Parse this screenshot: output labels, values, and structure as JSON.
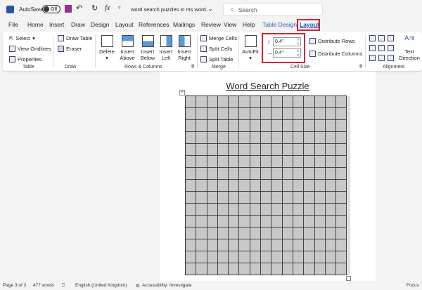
{
  "titlebar": {
    "autosave_label": "AutoSave",
    "autosave_state": "Off",
    "doc_title": "word search puzzles in ms word...",
    "search_placeholder": "Search"
  },
  "menu_tabs": [
    "File",
    "Home",
    "Insert",
    "Draw",
    "Design",
    "Layout",
    "References",
    "Mailings",
    "Review",
    "View",
    "Help",
    "Table Design",
    "Layout"
  ],
  "active_tab": "Layout",
  "ribbon": {
    "table": {
      "label": "Table",
      "select": "Select",
      "view_gridlines": "View Gridlines",
      "properties": "Properties"
    },
    "draw": {
      "label": "Draw",
      "draw_table": "Draw Table",
      "eraser": "Eraser"
    },
    "rows_columns": {
      "label": "Rows & Columns",
      "delete": "Delete",
      "insert_above": [
        "Insert",
        "Above"
      ],
      "insert_below": [
        "Insert",
        "Below"
      ],
      "insert_left": [
        "Insert",
        "Left"
      ],
      "insert_right": [
        "Insert",
        "Right"
      ]
    },
    "merge": {
      "label": "Merge",
      "merge_cells": "Merge Cells",
      "split_cells": "Split Cells",
      "split_table": "Split Table"
    },
    "cell_size": {
      "label": "Cell Size",
      "autofit": "AutoFit",
      "height": "0.4\"",
      "width": "0.4\"",
      "distribute_rows": "Distribute Rows",
      "distribute_columns": "Distribute Columns"
    },
    "alignment": {
      "label": "Alignment",
      "text_direction": [
        "Text",
        "Direction"
      ]
    }
  },
  "document": {
    "title": "Word Search Puzzle",
    "grid_rows": 15,
    "grid_cols": 15,
    "cell_color": "#c8c8c8"
  },
  "status": {
    "page": "Page 3 of 3",
    "words": "477 words",
    "language": "English (United Kingdom)",
    "accessibility": "Accessibility: Investigate",
    "focus": "Focus"
  },
  "colors": {
    "accent": "#2b579a",
    "highlight": "#d9232e",
    "table_design": "#2b5cb8"
  }
}
